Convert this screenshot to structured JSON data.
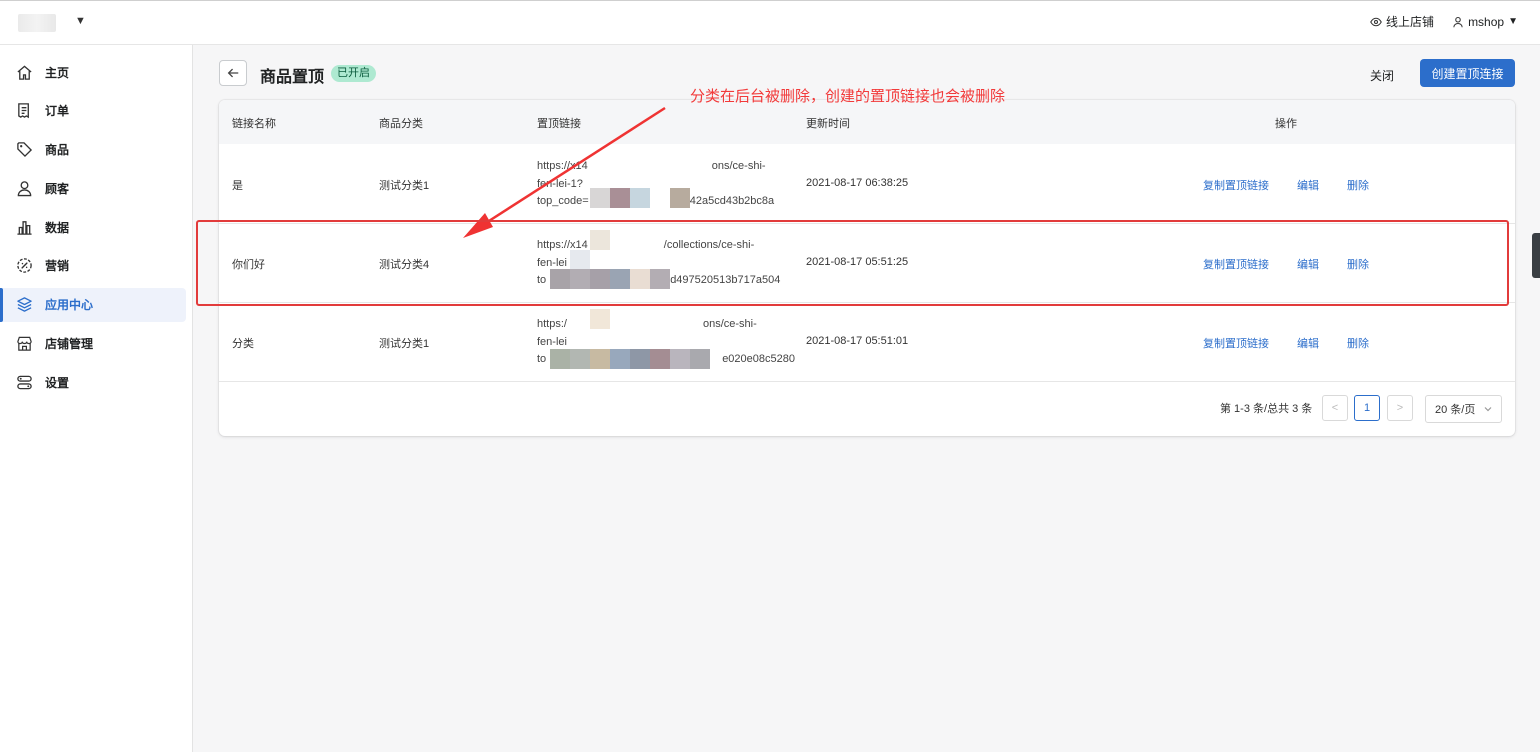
{
  "topbar": {
    "online_store": "线上店铺",
    "user": "mshop"
  },
  "sidebar": {
    "items": [
      {
        "label": "主页",
        "icon": "home-icon"
      },
      {
        "label": "订单",
        "icon": "order-icon"
      },
      {
        "label": "商品",
        "icon": "tag-icon"
      },
      {
        "label": "顾客",
        "icon": "person-icon"
      },
      {
        "label": "数据",
        "icon": "chart-icon"
      },
      {
        "label": "营销",
        "icon": "marketing-icon"
      },
      {
        "label": "应用中心",
        "icon": "layers-icon",
        "active": true
      },
      {
        "label": "店铺管理",
        "icon": "store-icon"
      },
      {
        "label": "设置",
        "icon": "settings-icon"
      }
    ]
  },
  "header": {
    "title": "商品置顶",
    "status": "已开启",
    "close": "关闭",
    "create": "创建置顶连接"
  },
  "annotation": "分类在后台被删除，创建的置顶链接也会被删除",
  "table": {
    "columns": [
      "链接名称",
      "商品分类",
      "置顶链接",
      "更新时间",
      "操作"
    ],
    "rows": [
      {
        "name": "是",
        "category": "测试分类1",
        "link_line1": "https://x14",
        "link_line1_end": "ons/ce-shi-",
        "link_line2": "fen-lei-1?",
        "link_line3": "top_code=",
        "link_line3_end": "f42a5cd43b2bc8a",
        "time": "2021-08-17 06:38:25"
      },
      {
        "name": "你们好",
        "category": "测试分类4",
        "link_line1": "https://x14",
        "link_line1_end": "/collections/ce-shi-",
        "link_line2": "fen-lei",
        "link_line3": "to",
        "link_line3_end": "d497520513b717a504",
        "time": "2021-08-17 05:51:25"
      },
      {
        "name": "分类",
        "category": "测试分类1",
        "link_line1": "https:/",
        "link_line1_end": "ons/ce-shi-",
        "link_line2": "fen-lei",
        "link_line3": "to",
        "link_line3_end": "e020e08c5280",
        "time": "2021-08-17 05:51:01"
      }
    ],
    "actions": {
      "copy": "复制置顶链接",
      "edit": "编辑",
      "delete": "删除"
    }
  },
  "pagination": {
    "summary": "第 1-3 条/总共 3 条",
    "current_page": "1",
    "page_size": "20 条/页"
  }
}
